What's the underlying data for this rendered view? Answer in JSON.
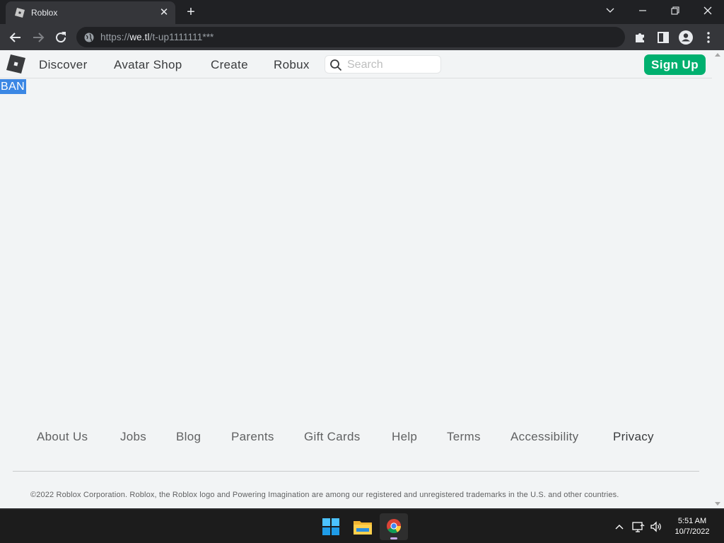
{
  "browser": {
    "tab_title": "Roblox",
    "url_scheme": "https://",
    "url_host": "we.tl",
    "url_path": "/t-up1111111***"
  },
  "header": {
    "nav": [
      "Discover",
      "Avatar Shop",
      "Create",
      "Robux"
    ],
    "search_placeholder": "Search",
    "signup_label": "Sign Up"
  },
  "content": {
    "highlighted_text": "BAN"
  },
  "footer": {
    "links": [
      "About Us",
      "Jobs",
      "Blog",
      "Parents",
      "Gift Cards",
      "Help",
      "Terms",
      "Accessibility",
      "Privacy"
    ],
    "copyright": "©2022 Roblox Corporation. Roblox, the Roblox logo and Powering Imagination are among our registered and unregistered trademarks in the U.S. and other countries."
  },
  "taskbar": {
    "time": "5:51 AM",
    "date": "10/7/2022"
  },
  "colors": {
    "accent_green": "#00b06f",
    "selection_blue": "#3b87e4",
    "page_bg": "#f2f4f5"
  }
}
